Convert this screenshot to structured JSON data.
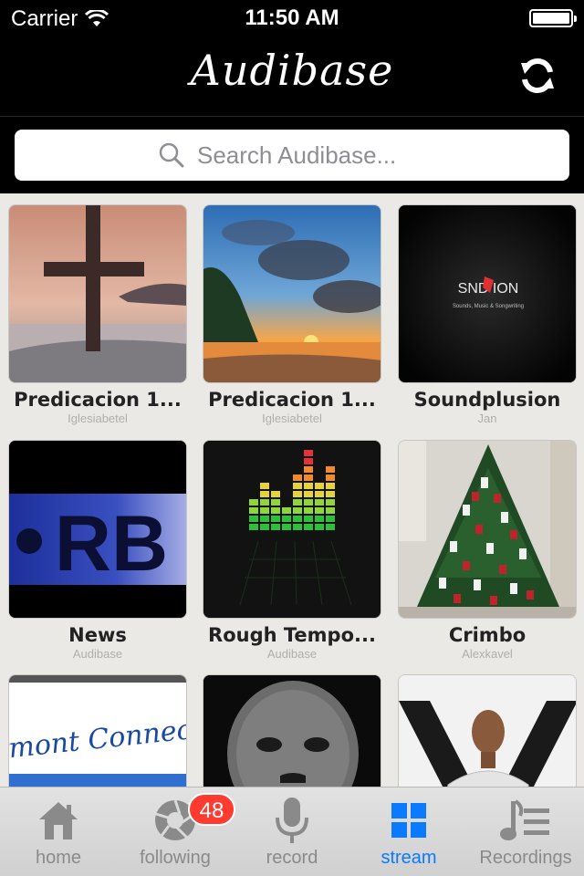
{
  "status_bar": {
    "carrier": "Carrier",
    "time": "11:50 AM"
  },
  "nav": {
    "title": "Audibase",
    "refresh_icon": "refresh-icon"
  },
  "search": {
    "placeholder": "Search Audibase...",
    "value": ""
  },
  "grid": {
    "items": [
      {
        "title": "Predicacion 1...",
        "author": "Iglesiabetel",
        "image": "cross-sunset"
      },
      {
        "title": "Predicacion 1...",
        "author": "Iglesiabetel",
        "image": "beach-sunset"
      },
      {
        "title": "Soundplusion",
        "author": "Jan",
        "image": "soundplusion-logo",
        "logo_text": "SND  ION",
        "logo_subtext": "Sounds, Music & Songwriting"
      },
      {
        "title": "News",
        "author": "Audibase",
        "image": "rb-logo",
        "logo_text": "RB"
      },
      {
        "title": "Rough Tempo...",
        "author": "Audibase",
        "image": "equalizer-bars"
      },
      {
        "title": "Crimbo",
        "author": "Alexkavel",
        "image": "christmas-tree"
      },
      {
        "title": "",
        "author": "",
        "image": "clermont-connection",
        "logo_text": "Clermont Connection"
      },
      {
        "title": "",
        "author": "",
        "image": "face-mosaic"
      },
      {
        "title": "",
        "author": "",
        "image": "x-portrait"
      }
    ]
  },
  "tab_bar": {
    "tabs": [
      {
        "label": "home",
        "icon": "house-icon",
        "active": false
      },
      {
        "label": "following",
        "icon": "aperture-icon",
        "active": false,
        "badge": "48"
      },
      {
        "label": "record",
        "icon": "microphone-icon",
        "active": false
      },
      {
        "label": "stream",
        "icon": "grid-icon",
        "active": true
      },
      {
        "label": "Recordings",
        "icon": "music-list-icon",
        "active": false
      }
    ]
  },
  "colors": {
    "accent": "#0a7aff",
    "badge": "#ff3b30",
    "inactive": "#8a8a8a",
    "grid_bg": "#ebe9e6"
  }
}
